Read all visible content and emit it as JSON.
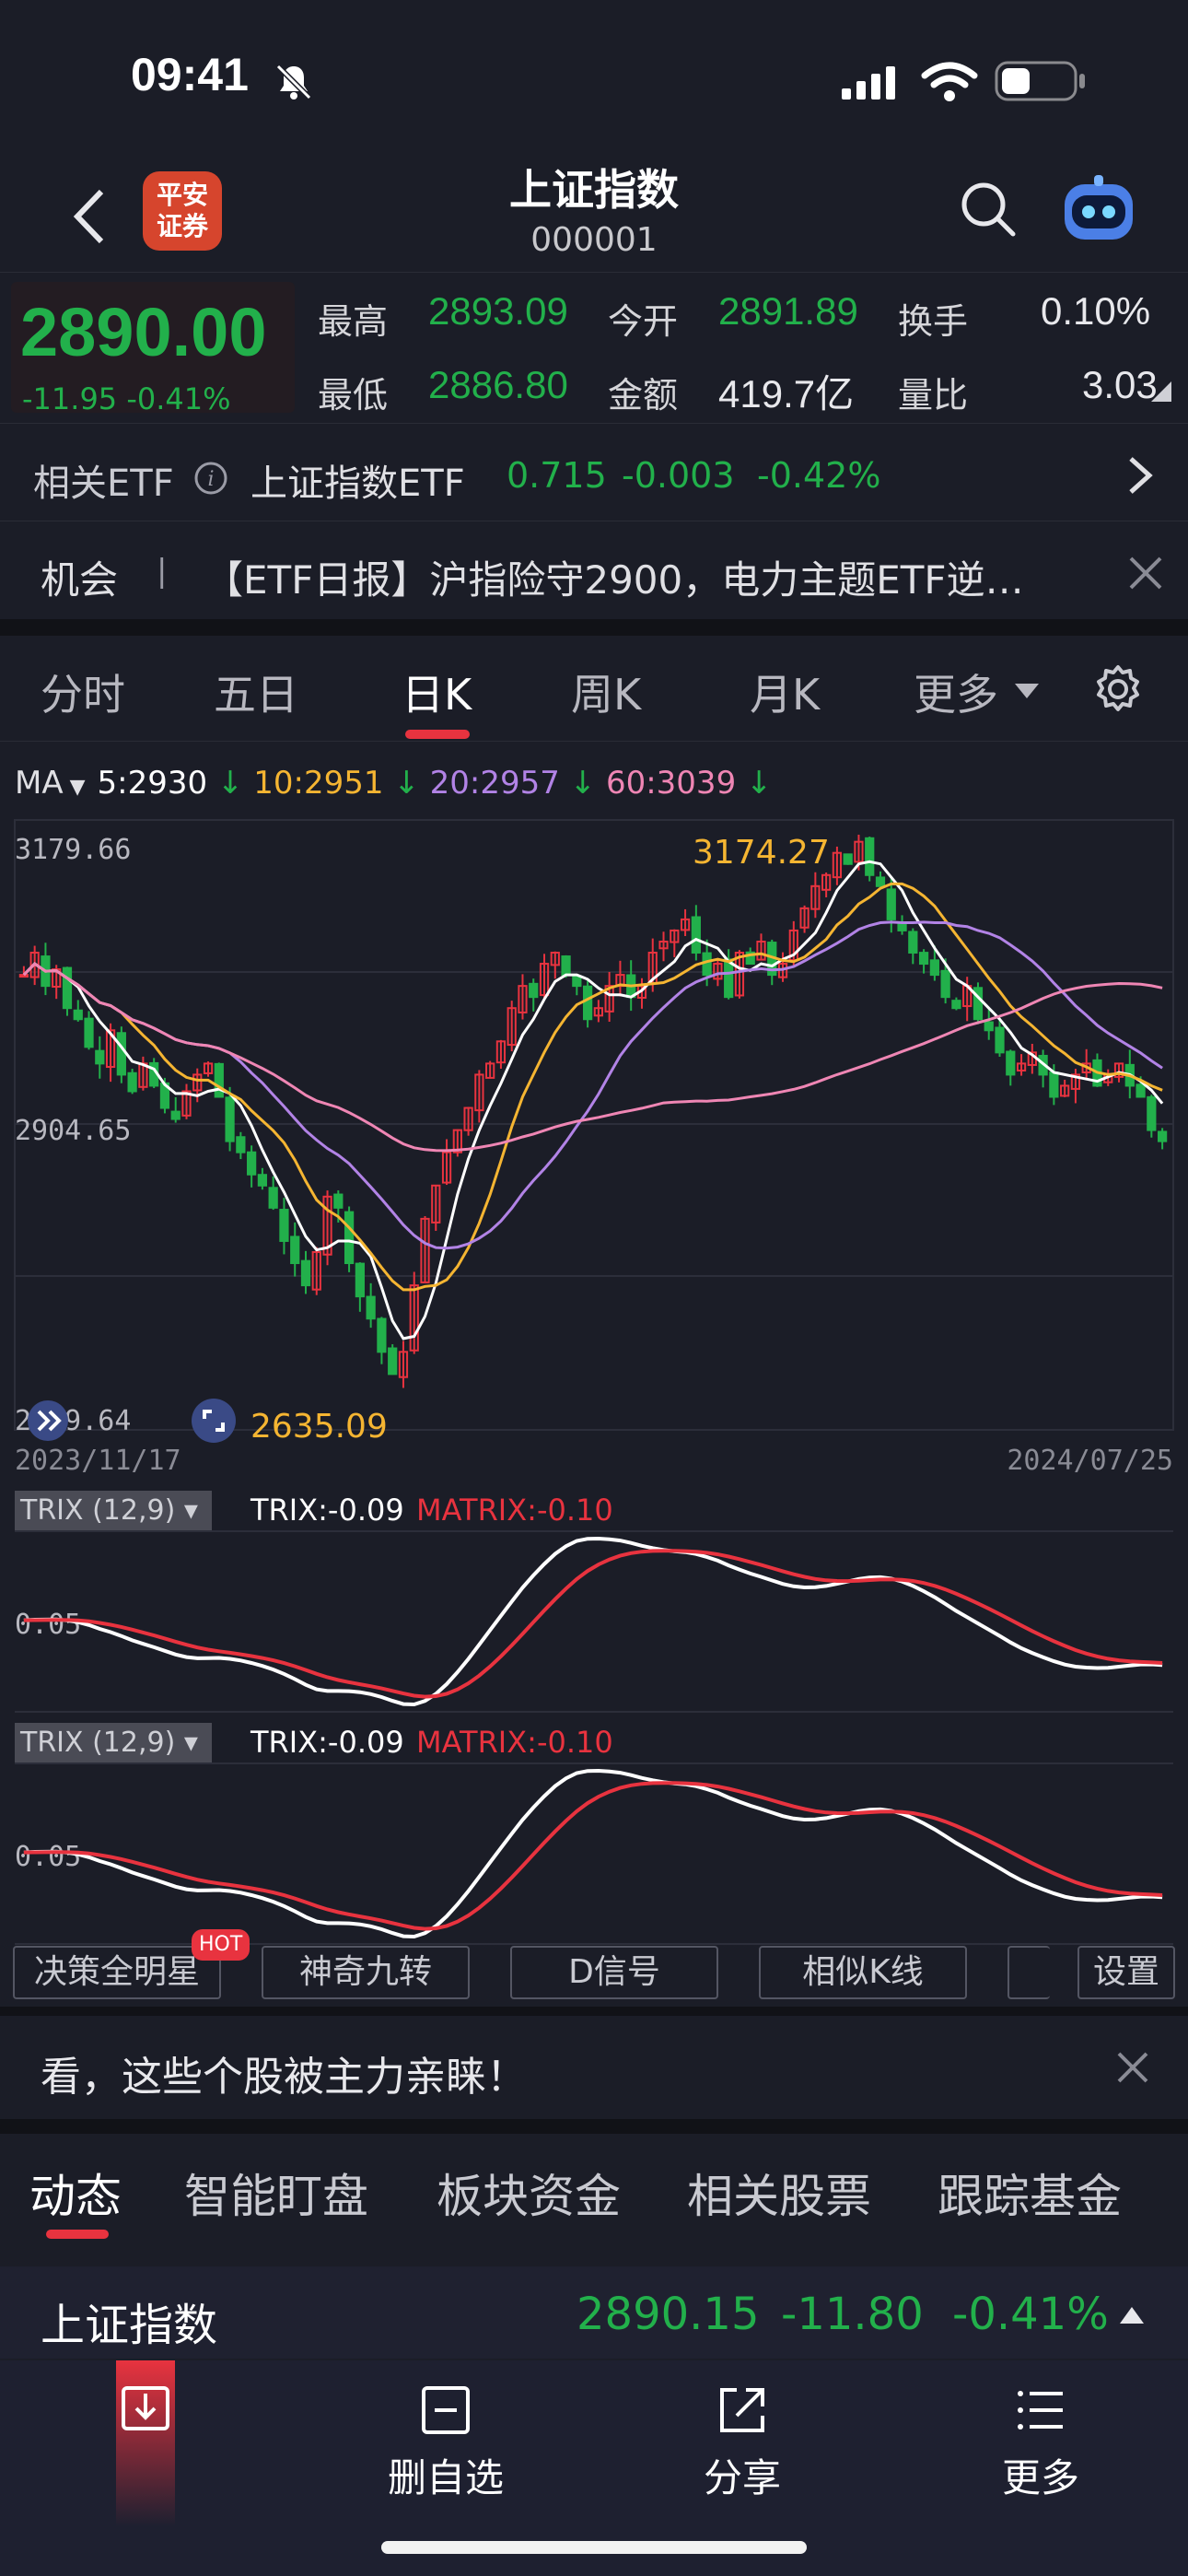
{
  "status": {
    "time": "09:41"
  },
  "header": {
    "logo_text": "平安\n证券",
    "title": "上证指数",
    "code": "000001"
  },
  "quote": {
    "last": "2890.00",
    "change": "-11.95 -0.41%",
    "high_label": "最高",
    "high": "2893.09",
    "open_label": "今开",
    "open": "2891.89",
    "turnover_label": "换手",
    "turnover": "0.10%",
    "low_label": "最低",
    "low": "2886.80",
    "amount_label": "金额",
    "amount": "419.7亿",
    "volratio_label": "量比",
    "volratio": "3.03"
  },
  "etf": {
    "label": "相关ETF",
    "name": "上证指数ETF",
    "price": "0.715",
    "change": "-0.003",
    "pct": "-0.42%"
  },
  "news": {
    "tag": "机会",
    "sep": "|",
    "text": "【ETF日报】沪指险守2900，电力主题ETF逆…"
  },
  "chart_tabs": [
    {
      "label": "分时"
    },
    {
      "label": "五日"
    },
    {
      "label": "日K"
    },
    {
      "label": "周K"
    },
    {
      "label": "月K"
    },
    {
      "label": "更多"
    }
  ],
  "ma_legend": {
    "label": "MA",
    "ma5": "5:2930",
    "ma10": "10:2951",
    "ma20": "20:2957",
    "ma60": "60:3039"
  },
  "colors": {
    "up": "#e8333f",
    "down": "#22b04b",
    "ma5": "#ffffff",
    "ma10": "#f5b532",
    "ma20": "#b283e6",
    "ma60": "#ef86b4",
    "bg": "#1b1d27"
  },
  "chart_data": {
    "type": "candlestick",
    "y_top_label": "3179.66",
    "y_mid_label": "2904.65",
    "y_bottom_label": "2629.64",
    "ylim": [
      2629.64,
      3179.66
    ],
    "x_start_label": "2023/11/17",
    "x_end_label": "2024/07/25",
    "max_annotation": "3174.27",
    "min_annotation": "2635.09",
    "close_series": [
      3040,
      3060,
      3030,
      3045,
      3010,
      3000,
      2975,
      2960,
      2990,
      2950,
      2935,
      2960,
      2940,
      2920,
      2910,
      2935,
      2950,
      2960,
      2930,
      2890,
      2880,
      2860,
      2850,
      2830,
      2800,
      2780,
      2760,
      2790,
      2840,
      2830,
      2780,
      2750,
      2730,
      2700,
      2680,
      2700,
      2760,
      2820,
      2850,
      2880,
      2900,
      2920,
      2950,
      2960,
      2980,
      3010,
      3030,
      3020,
      3050,
      3060,
      3040,
      3030,
      3000,
      3010,
      3030,
      3040,
      3020,
      3030,
      3060,
      3070,
      3080,
      3090,
      3060,
      3040,
      3050,
      3020,
      3060,
      3050,
      3070,
      3040,
      3050,
      3080,
      3100,
      3120,
      3130,
      3150,
      3140,
      3160,
      3130,
      3120,
      3090,
      3080,
      3060,
      3050,
      3040,
      3020,
      3010,
      3030,
      3000,
      2990,
      2970,
      2950,
      2960,
      2970,
      2950,
      2930,
      2940,
      2950,
      2960,
      2940,
      2950,
      2960,
      2940,
      2930,
      2900,
      2890
    ],
    "trix": {
      "label": "TRIX (12,9)",
      "trix_value": "TRIX:-0.09",
      "matrix_value": "MATRIX:-0.10",
      "ref_label": "0.05"
    }
  },
  "indicators": {
    "b1": "决策全明星",
    "hot": "HOT",
    "b2": "神奇九转",
    "b3": "D信号",
    "b4": "相似K线",
    "b5": "设置"
  },
  "promo": {
    "text": "看，这些个股被主力亲睐！"
  },
  "bottom_tabs": [
    {
      "label": "动态"
    },
    {
      "label": "智能盯盘"
    },
    {
      "label": "板块资金"
    },
    {
      "label": "相关股票"
    },
    {
      "label": "跟踪基金"
    }
  ],
  "ticker": {
    "name": "上证指数",
    "price": "2890.15",
    "change": "-11.80",
    "pct": "-0.41%"
  },
  "toolbar": {
    "remove": "删自选",
    "share": "分享",
    "more": "更多"
  }
}
